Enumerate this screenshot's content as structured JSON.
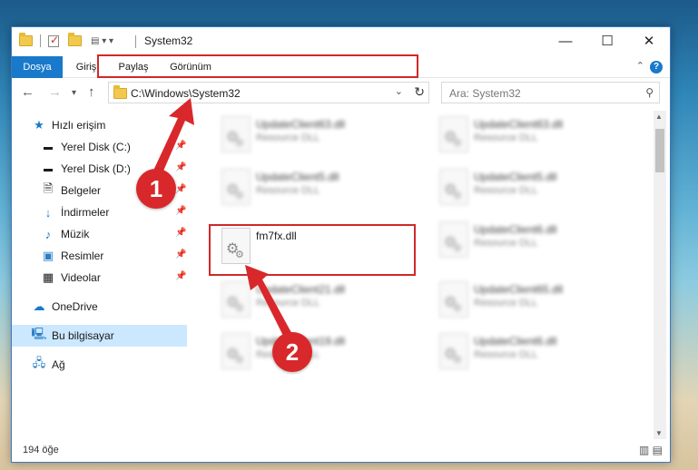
{
  "window": {
    "title": "System32",
    "controls": {
      "minimize": "—",
      "maximize": "☐",
      "close": "✕"
    }
  },
  "ribbon": {
    "tabs": [
      "Dosya",
      "Giriş",
      "Paylaş",
      "Görünüm"
    ]
  },
  "address": {
    "path": "C:\\Windows\\System32",
    "search_placeholder": "Ara: System32"
  },
  "sidebar": {
    "items": [
      {
        "label": "Hızlı erişim",
        "icon": "star-icon",
        "pinned": false
      },
      {
        "label": "Yerel Disk (C:)",
        "icon": "drive-icon",
        "pinned": true
      },
      {
        "label": "Yerel Disk (D:)",
        "icon": "drive-icon",
        "pinned": true
      },
      {
        "label": "Belgeler",
        "icon": "document-icon",
        "pinned": true
      },
      {
        "label": "İndirmeler",
        "icon": "download-icon",
        "pinned": true
      },
      {
        "label": "Müzik",
        "icon": "music-icon",
        "pinned": true
      },
      {
        "label": "Resimler",
        "icon": "picture-icon",
        "pinned": true
      },
      {
        "label": "Videolar",
        "icon": "video-icon",
        "pinned": true
      },
      {
        "label": "OneDrive",
        "icon": "cloud-icon",
        "pinned": false
      },
      {
        "label": "Bu bilgisayar",
        "icon": "computer-icon",
        "pinned": false,
        "selected": true
      },
      {
        "label": "Ağ",
        "icon": "network-icon",
        "pinned": false
      }
    ]
  },
  "files": [
    {
      "name": "UpdateClient63.dll",
      "type": "Resource DLL",
      "blurred": true
    },
    {
      "name": "UpdateClient63.dll",
      "type": "Resource DLL",
      "blurred": true
    },
    {
      "name": "UpdateClient5.dll",
      "type": "Resource DLL",
      "blurred": true
    },
    {
      "name": "UpdateClient5.dll",
      "type": "Resource DLL",
      "blurred": true
    },
    {
      "name": "fm7fx.dll",
      "type": "",
      "blurred": false
    },
    {
      "name": "UpdateClient6.dll",
      "type": "Resource DLL",
      "blurred": true
    },
    {
      "name": "UpdateClient21.dll",
      "type": "Resource DLL",
      "blurred": true
    },
    {
      "name": "UpdateClient65.dll",
      "type": "Resource DLL",
      "blurred": true
    },
    {
      "name": "UpdateClient19.dll",
      "type": "Resource DLL",
      "blurred": true
    },
    {
      "name": "UpdateClient6.dll",
      "type": "Resource DLL",
      "blurred": true
    }
  ],
  "status": {
    "count": "194 öğe"
  },
  "markers": {
    "one": "1",
    "two": "2"
  },
  "colors": {
    "accent": "#1979ca",
    "highlight": "#d12828",
    "selected": "#cce8ff"
  }
}
